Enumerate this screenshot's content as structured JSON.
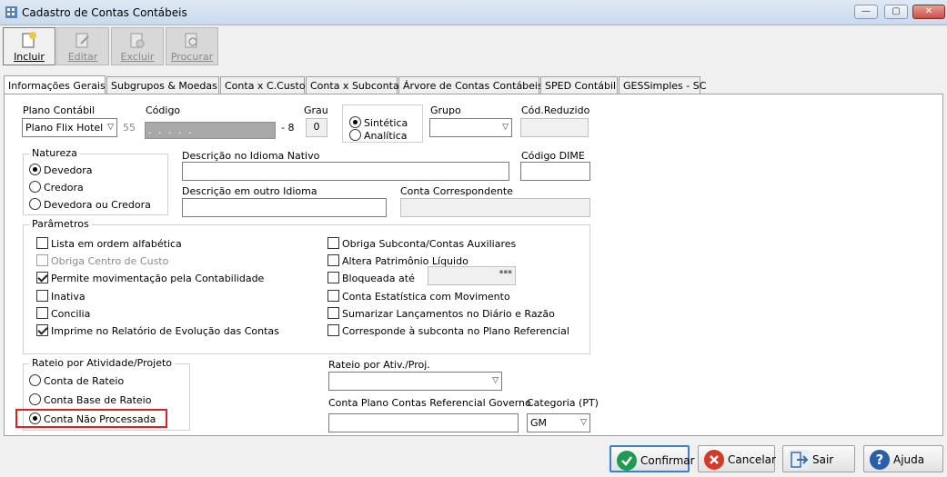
{
  "window": {
    "title": "Cadastro de Contas Contábeis"
  },
  "toolbar": {
    "incluir": "Incluir",
    "editar": "Editar",
    "excluir": "Excluir",
    "procurar": "Procurar"
  },
  "tabs": [
    "Informações Gerais",
    "Subgrupos & Moedas",
    "Conta x C.Custo",
    "Conta x Subconta",
    "Árvore de Contas Contábeis",
    "SPED Contábil",
    "GESSimples - SC"
  ],
  "fields": {
    "plano_label": "Plano Contábil",
    "plano_value": "Plano Flix Hotel",
    "plano_num": "55",
    "codigo_label": "Código",
    "codigo_value": ". . . . .",
    "codigo_suffix": "- 8",
    "grau_label": "Grau",
    "grau_value": "0",
    "sintetica": "Sintética",
    "analitica": "Analítica",
    "grupo_label": "Grupo",
    "cod_reduzido_label": "Cód.Reduzido",
    "desc_nativo_label": "Descrição no Idioma Nativo",
    "codigo_dime_label": "Código DIME",
    "desc_outro_label": "Descrição em outro Idioma",
    "conta_corresp_label": "Conta Correspondente"
  },
  "natureza": {
    "title": "Natureza",
    "options": [
      "Devedora",
      "Credora",
      "Devedora ou Credora"
    ]
  },
  "parametros": {
    "title": "Parâmetros",
    "left": [
      "Lista em ordem alfabética",
      "Obriga Centro de Custo",
      "Permite movimentação pela Contabilidade",
      "Inativa",
      "Concilia",
      "Imprime no Relatório de Evolução das Contas"
    ],
    "right": [
      "Obriga Subconta/Contas Auxiliares",
      "Altera Patrimônio Líquido",
      "Bloqueada até",
      "Conta Estatística com Movimento",
      "Sumarizar Lançamentos no Diário e Razão",
      "Corresponde à subconta no Plano Referencial"
    ]
  },
  "rateio": {
    "title": "Rateio por Atividade/Projeto",
    "options": [
      "Conta de Rateio",
      "Conta Base de Rateio",
      "Conta Não Processada"
    ],
    "ativ_label": "Rateio por Ativ./Proj.",
    "referencial_label": "Conta Plano Contas Referencial Governo",
    "categoria_label": "Categoria (PT)",
    "categoria_value": "GM"
  },
  "buttons": {
    "confirmar": "Confirmar",
    "cancelar": "Cancelar",
    "sair": "Sair",
    "ajuda": "Ajuda"
  }
}
